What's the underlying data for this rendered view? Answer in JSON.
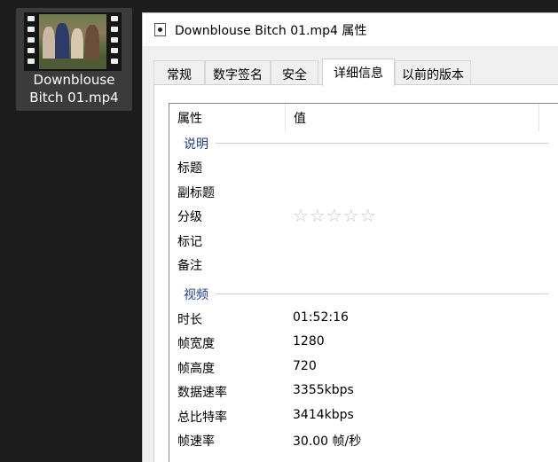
{
  "desktop": {
    "file_name_line1": "Downblouse",
    "file_name_line2": "Bitch 01.mp4",
    "icon": "video-thumbnail-icon"
  },
  "window": {
    "title": "Downblouse Bitch 01.mp4 属性",
    "icon": "video-file-icon"
  },
  "tabs": [
    {
      "label": "常规"
    },
    {
      "label": "数字签名"
    },
    {
      "label": "安全"
    },
    {
      "label": "详细信息"
    },
    {
      "label": "以前的版本"
    }
  ],
  "active_tab": "详细信息",
  "list": {
    "col_property": "属性",
    "col_value": "值",
    "groups": [
      {
        "label": "说明",
        "rows": [
          {
            "key": "标题",
            "value": ""
          },
          {
            "key": "副标题",
            "value": ""
          },
          {
            "key": "分级",
            "value": "☆☆☆☆☆",
            "rating": 0,
            "max_rating": 5
          },
          {
            "key": "标记",
            "value": ""
          },
          {
            "key": "备注",
            "value": ""
          }
        ]
      },
      {
        "label": "视频",
        "rows": [
          {
            "key": "时长",
            "value": "01:52:16"
          },
          {
            "key": "帧宽度",
            "value": "1280"
          },
          {
            "key": "帧高度",
            "value": "720"
          },
          {
            "key": "数据速率",
            "value": "3355kbps"
          },
          {
            "key": "总比特率",
            "value": "3414kbps"
          },
          {
            "key": "帧速率",
            "value": "30.00 帧/秒"
          }
        ]
      }
    ]
  },
  "colors": {
    "desktop_bg": "#1c1c1c",
    "group_header": "#1e3d8a",
    "window_bg": "#f0f0f0"
  }
}
